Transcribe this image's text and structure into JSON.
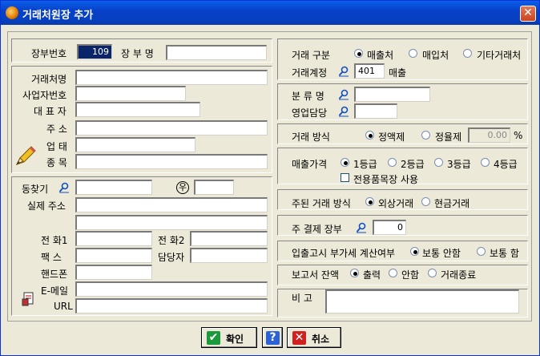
{
  "window": {
    "title": "거래처원장 추가",
    "close": "✕"
  },
  "left": {
    "ledger_no_label": "장부번호",
    "ledger_no_value": "109",
    "ledger_name_label": "장 부 명",
    "partner_name_label": "거래처명",
    "biz_no_label": "사업자번호",
    "ceo_label": "대 표 자",
    "address_label": "주 소",
    "biz_type_label": "업 태",
    "biz_item_label": "종 목",
    "search_label": "동찾기",
    "zip_symbol": "우",
    "real_address_label": "실제 주소",
    "phone1_label": "전 화1",
    "phone2_label": "전 화2",
    "fax_label": "팩 스",
    "manager_label": "담당자",
    "mobile_label": "핸드폰",
    "email_label": "E-메일",
    "url_label": "URL"
  },
  "right": {
    "trade_type_label": "거래 구분",
    "trade_types": [
      "매출처",
      "매입처",
      "기타거래처"
    ],
    "account_label": "거래계정",
    "account_value": "401",
    "account_name": "매출",
    "category_label": "분 류 명",
    "sales_manager_label": "영업담당",
    "method_label": "거래 방식",
    "methods": [
      "정액제",
      "정율제"
    ],
    "rate_value": "0.00",
    "rate_unit": "%",
    "price_label": "매출가격",
    "grades": [
      "1등급",
      "2등급",
      "3등급",
      "4등급"
    ],
    "dedicated_label": "전용품목장 사용",
    "main_method_label": "주된 거래 방식",
    "main_methods": [
      "외상거래",
      "현금거래"
    ],
    "settle_label": "주 결제 장부",
    "settle_value": "0",
    "vat_label": "입출고시 부가세 계산여부",
    "vat_options": [
      "보통 안함",
      "보통 함"
    ],
    "report_label": "보고서 잔액",
    "report_options": [
      "출력",
      "안함",
      "거래종료"
    ],
    "memo_label": "비 고"
  },
  "buttons": {
    "ok": "확인",
    "help": "?",
    "cancel": "취소"
  }
}
